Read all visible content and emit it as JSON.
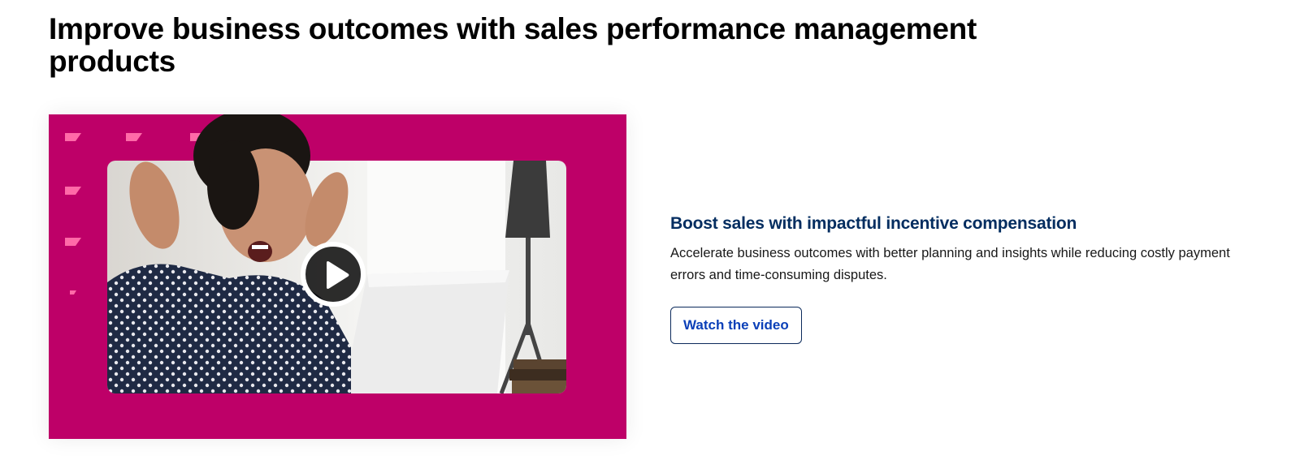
{
  "section": {
    "title": "Improve business outcomes with sales performance management products"
  },
  "media": {
    "background_color": "#be0068",
    "accent_color": "#ff6aa8",
    "play_icon": "play-icon"
  },
  "content": {
    "heading": "Boost sales with impactful incentive compensation",
    "description": "Accelerate business outcomes with better planning and insights while reducing costly payment errors and time-consuming disputes.",
    "button_label": "Watch the video"
  }
}
